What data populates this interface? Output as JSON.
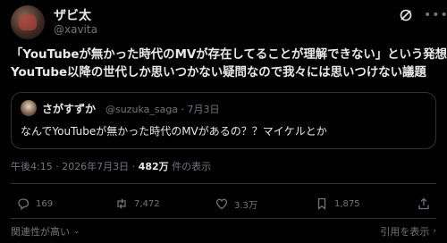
{
  "author": {
    "name": "ザビ太",
    "handle": "@xavita"
  },
  "tweet": {
    "line1": "「YouTubeが無かった時代のMVが存在してることが理解できない」という発想は",
    "line2": "YouTube以降の世代しか思いつかない疑問なので我々には思いつけない議題"
  },
  "quote": {
    "name": "さがすずか",
    "handle_date": "@suzuka_saga · 7月3日",
    "text": "なんでYouTubeが無かった時代のMVがあるの？？マイケルとか"
  },
  "meta": {
    "time_date": "午後4:15 · 2026年7月3日 · ",
    "views": "482万",
    "views_label": " 件の表示"
  },
  "actions": {
    "replies": "169",
    "reposts": "7,472",
    "likes": "3.3万",
    "bookmarks": "1,875"
  },
  "footer": {
    "sort_label": "関連性が高い",
    "quote_link": "引用を表示"
  },
  "icons": {
    "grok": "grok-icon",
    "more": "more-icon"
  }
}
